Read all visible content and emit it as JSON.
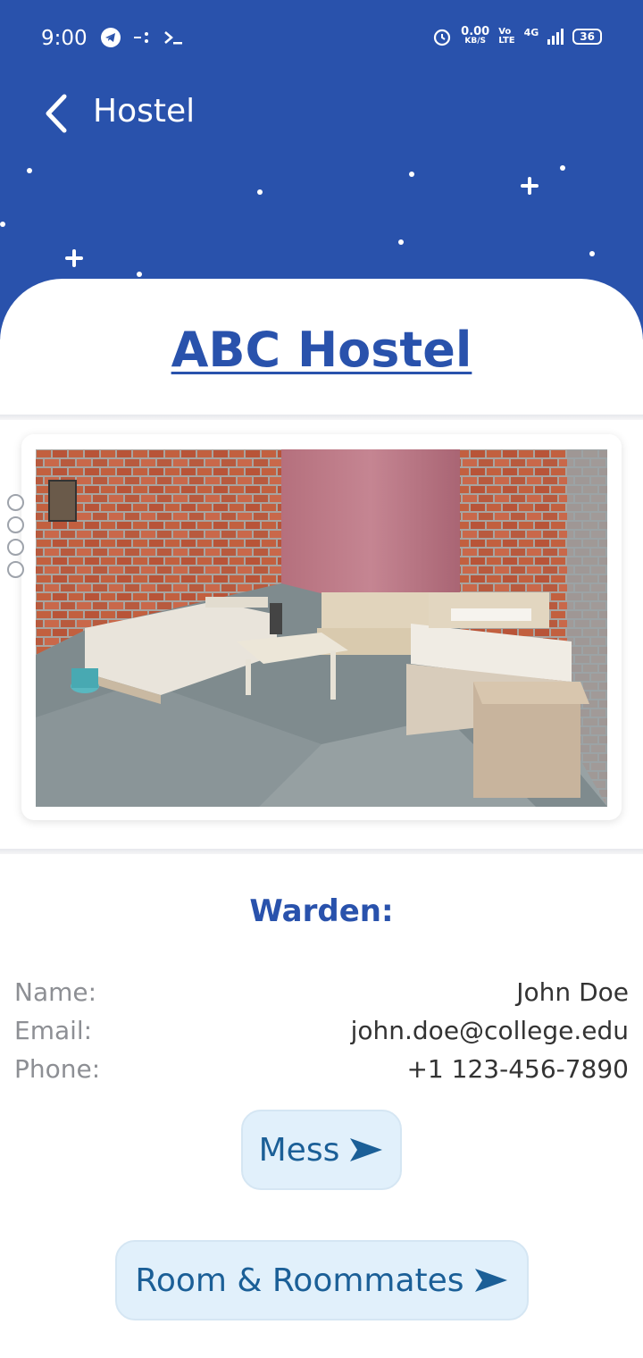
{
  "status_bar": {
    "time": "9:00",
    "net_speed_value": "0.00",
    "net_speed_unit": "KB/S",
    "volte_top": "Vo",
    "volte_bottom": "LTE",
    "network": "4G",
    "battery": "36",
    "icons": [
      "telegram-icon",
      "data-saver-icon",
      "terminal-icon",
      "alarm-icon",
      "signal-icon",
      "battery-icon"
    ]
  },
  "header": {
    "title": "Hostel",
    "background_color": "#2952ac"
  },
  "hostel": {
    "name": "ABC Hostel",
    "image_caption": ""
  },
  "warden": {
    "heading": "Warden:",
    "rows": [
      {
        "label": "Name:",
        "value": "John Doe"
      },
      {
        "label": "Email:",
        "value": "john.doe@college.edu"
      },
      {
        "label": "Phone:",
        "value": "+1 123-456-7890"
      }
    ]
  },
  "buttons": {
    "mess": "Mess",
    "room": "Room & Roommates"
  },
  "colors": {
    "accent": "#2952ac",
    "button_bg": "#e1f0fb",
    "button_text": "#1b5f97"
  }
}
